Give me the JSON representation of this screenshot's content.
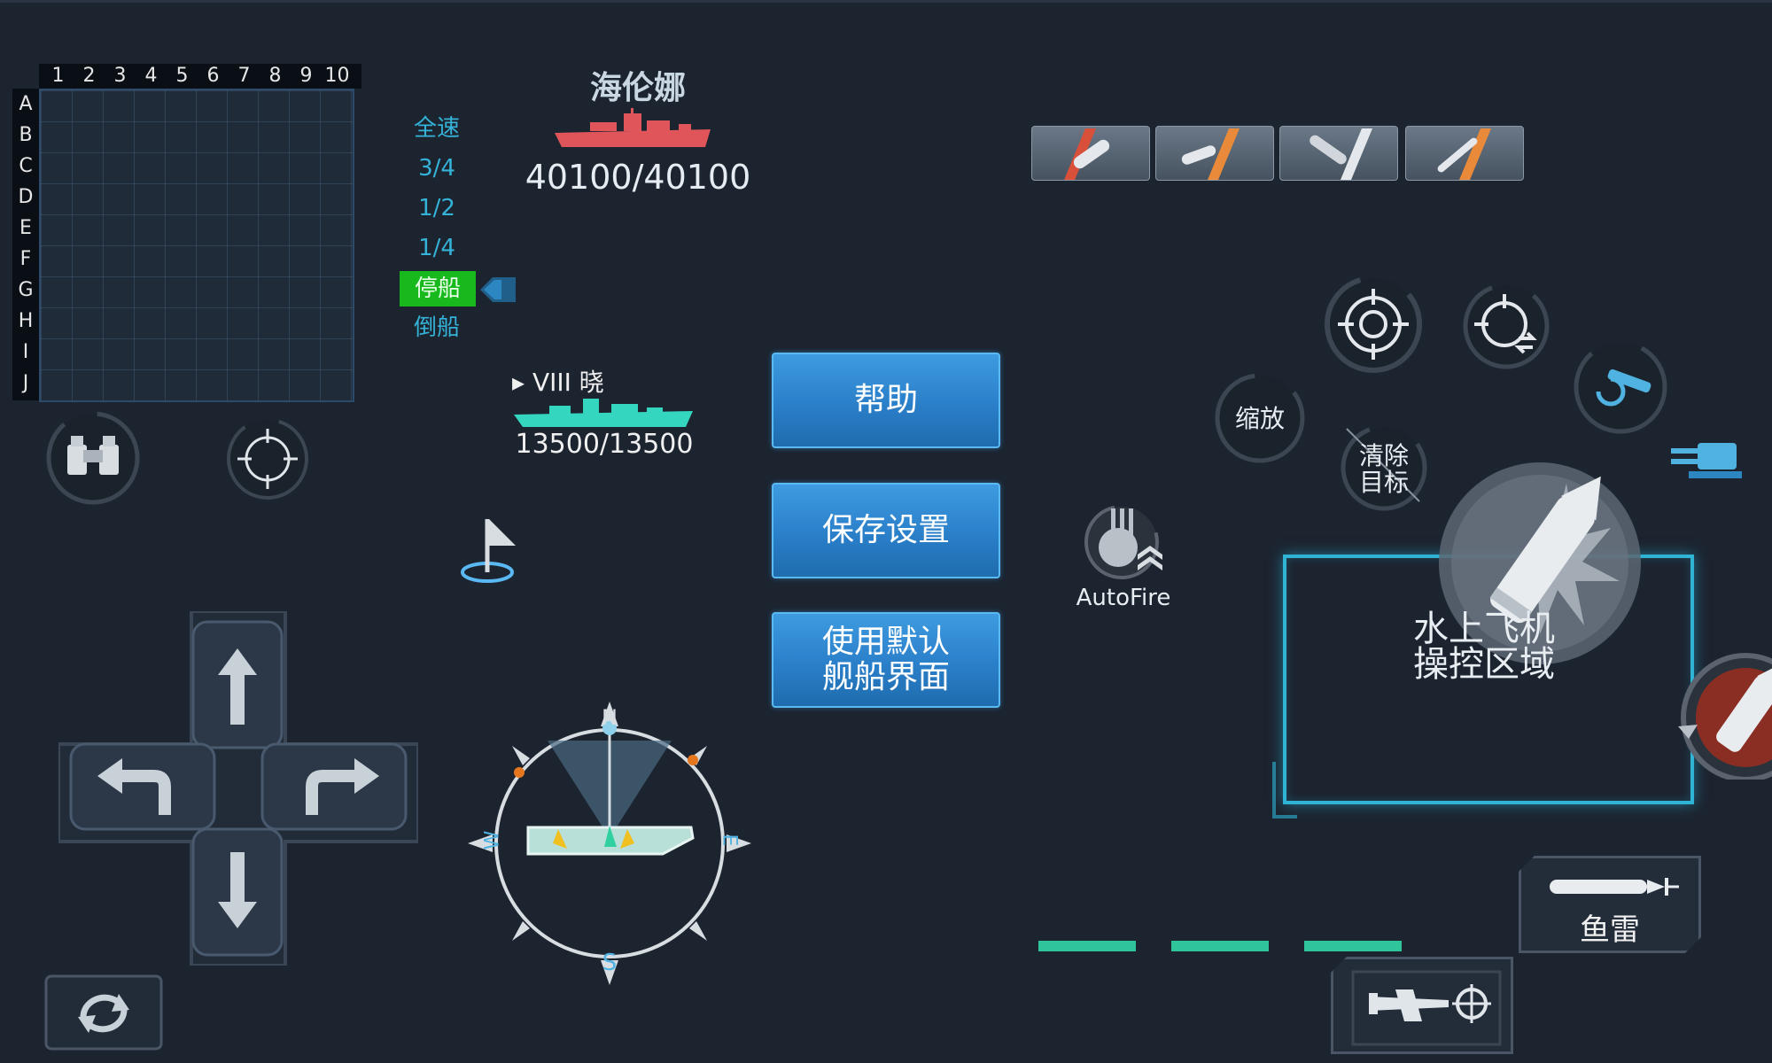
{
  "minimap": {
    "columns": [
      "1",
      "2",
      "3",
      "4",
      "5",
      "6",
      "7",
      "8",
      "9",
      "10"
    ],
    "rows": [
      "A",
      "B",
      "C",
      "D",
      "E",
      "F",
      "G",
      "H",
      "I",
      "J"
    ]
  },
  "speed": {
    "levels": [
      "全速",
      "3/4",
      "1/2",
      "1/4",
      "停船",
      "倒船"
    ],
    "active_index": 4
  },
  "player_ship": {
    "name": "海伦娜",
    "hp": "40100/40100",
    "silhouette_color": "#e0555a"
  },
  "target_ship": {
    "label": "▸ VIII  晓",
    "hp": "13500/13500",
    "silhouette_color": "#35d6c0"
  },
  "menu": {
    "help": "帮助",
    "save_settings": "保存设置",
    "default_layout_line1": "使用默认",
    "default_layout_line2": "舰船界面"
  },
  "controls": {
    "zoom": "缩放",
    "clear_target_line1": "清除",
    "clear_target_line2": "目标",
    "autofire": "AutoFire",
    "seaplane_area_line1": "水上飞机",
    "seaplane_area_line2": "操控区域",
    "torpedo": "鱼雷"
  },
  "compass": {
    "north": "N",
    "south": "S",
    "east": "E",
    "west": "W"
  },
  "weapon_tabs": [
    "ap-shell-icon",
    "he-shell-icon",
    "aa-shell-icon",
    "torpedo-shell-icon"
  ],
  "colors": {
    "accent_blue": "#2a7fc9",
    "speed_text": "#34b2d8",
    "speed_active": "#17b91d",
    "reload_bar": "#30c49a",
    "seaplane_frame": "#2fb4d6"
  }
}
